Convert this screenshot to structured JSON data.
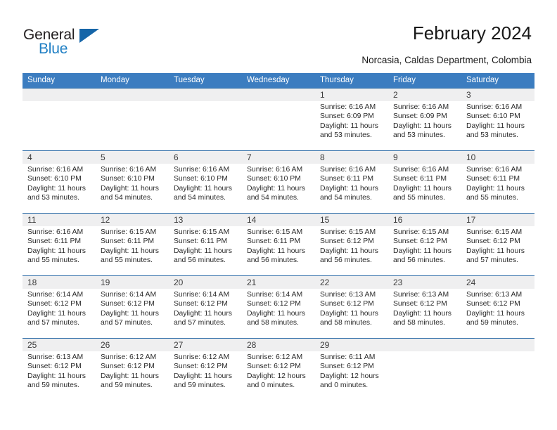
{
  "brand": {
    "name_top": "General",
    "name_bottom": "Blue"
  },
  "header": {
    "title": "February 2024",
    "subtitle": "Norcasia, Caldas Department, Colombia"
  },
  "colors": {
    "header_blue": "#3c7dc0",
    "row_divider_blue": "#2e6da8",
    "daynum_band_gray": "#efeff0",
    "brand_blue": "#1f7fc4",
    "brand_dark": "#231f20"
  },
  "weekdays": [
    "Sunday",
    "Monday",
    "Tuesday",
    "Wednesday",
    "Thursday",
    "Friday",
    "Saturday"
  ],
  "weeks": [
    [
      {
        "day": "",
        "sunrise": "",
        "sunset": "",
        "daylight1": "",
        "daylight2": ""
      },
      {
        "day": "",
        "sunrise": "",
        "sunset": "",
        "daylight1": "",
        "daylight2": ""
      },
      {
        "day": "",
        "sunrise": "",
        "sunset": "",
        "daylight1": "",
        "daylight2": ""
      },
      {
        "day": "",
        "sunrise": "",
        "sunset": "",
        "daylight1": "",
        "daylight2": ""
      },
      {
        "day": "1",
        "sunrise": "Sunrise: 6:16 AM",
        "sunset": "Sunset: 6:09 PM",
        "daylight1": "Daylight: 11 hours",
        "daylight2": "and 53 minutes."
      },
      {
        "day": "2",
        "sunrise": "Sunrise: 6:16 AM",
        "sunset": "Sunset: 6:09 PM",
        "daylight1": "Daylight: 11 hours",
        "daylight2": "and 53 minutes."
      },
      {
        "day": "3",
        "sunrise": "Sunrise: 6:16 AM",
        "sunset": "Sunset: 6:10 PM",
        "daylight1": "Daylight: 11 hours",
        "daylight2": "and 53 minutes."
      }
    ],
    [
      {
        "day": "4",
        "sunrise": "Sunrise: 6:16 AM",
        "sunset": "Sunset: 6:10 PM",
        "daylight1": "Daylight: 11 hours",
        "daylight2": "and 53 minutes."
      },
      {
        "day": "5",
        "sunrise": "Sunrise: 6:16 AM",
        "sunset": "Sunset: 6:10 PM",
        "daylight1": "Daylight: 11 hours",
        "daylight2": "and 54 minutes."
      },
      {
        "day": "6",
        "sunrise": "Sunrise: 6:16 AM",
        "sunset": "Sunset: 6:10 PM",
        "daylight1": "Daylight: 11 hours",
        "daylight2": "and 54 minutes."
      },
      {
        "day": "7",
        "sunrise": "Sunrise: 6:16 AM",
        "sunset": "Sunset: 6:10 PM",
        "daylight1": "Daylight: 11 hours",
        "daylight2": "and 54 minutes."
      },
      {
        "day": "8",
        "sunrise": "Sunrise: 6:16 AM",
        "sunset": "Sunset: 6:11 PM",
        "daylight1": "Daylight: 11 hours",
        "daylight2": "and 54 minutes."
      },
      {
        "day": "9",
        "sunrise": "Sunrise: 6:16 AM",
        "sunset": "Sunset: 6:11 PM",
        "daylight1": "Daylight: 11 hours",
        "daylight2": "and 55 minutes."
      },
      {
        "day": "10",
        "sunrise": "Sunrise: 6:16 AM",
        "sunset": "Sunset: 6:11 PM",
        "daylight1": "Daylight: 11 hours",
        "daylight2": "and 55 minutes."
      }
    ],
    [
      {
        "day": "11",
        "sunrise": "Sunrise: 6:16 AM",
        "sunset": "Sunset: 6:11 PM",
        "daylight1": "Daylight: 11 hours",
        "daylight2": "and 55 minutes."
      },
      {
        "day": "12",
        "sunrise": "Sunrise: 6:15 AM",
        "sunset": "Sunset: 6:11 PM",
        "daylight1": "Daylight: 11 hours",
        "daylight2": "and 55 minutes."
      },
      {
        "day": "13",
        "sunrise": "Sunrise: 6:15 AM",
        "sunset": "Sunset: 6:11 PM",
        "daylight1": "Daylight: 11 hours",
        "daylight2": "and 56 minutes."
      },
      {
        "day": "14",
        "sunrise": "Sunrise: 6:15 AM",
        "sunset": "Sunset: 6:11 PM",
        "daylight1": "Daylight: 11 hours",
        "daylight2": "and 56 minutes."
      },
      {
        "day": "15",
        "sunrise": "Sunrise: 6:15 AM",
        "sunset": "Sunset: 6:12 PM",
        "daylight1": "Daylight: 11 hours",
        "daylight2": "and 56 minutes."
      },
      {
        "day": "16",
        "sunrise": "Sunrise: 6:15 AM",
        "sunset": "Sunset: 6:12 PM",
        "daylight1": "Daylight: 11 hours",
        "daylight2": "and 56 minutes."
      },
      {
        "day": "17",
        "sunrise": "Sunrise: 6:15 AM",
        "sunset": "Sunset: 6:12 PM",
        "daylight1": "Daylight: 11 hours",
        "daylight2": "and 57 minutes."
      }
    ],
    [
      {
        "day": "18",
        "sunrise": "Sunrise: 6:14 AM",
        "sunset": "Sunset: 6:12 PM",
        "daylight1": "Daylight: 11 hours",
        "daylight2": "and 57 minutes."
      },
      {
        "day": "19",
        "sunrise": "Sunrise: 6:14 AM",
        "sunset": "Sunset: 6:12 PM",
        "daylight1": "Daylight: 11 hours",
        "daylight2": "and 57 minutes."
      },
      {
        "day": "20",
        "sunrise": "Sunrise: 6:14 AM",
        "sunset": "Sunset: 6:12 PM",
        "daylight1": "Daylight: 11 hours",
        "daylight2": "and 57 minutes."
      },
      {
        "day": "21",
        "sunrise": "Sunrise: 6:14 AM",
        "sunset": "Sunset: 6:12 PM",
        "daylight1": "Daylight: 11 hours",
        "daylight2": "and 58 minutes."
      },
      {
        "day": "22",
        "sunrise": "Sunrise: 6:13 AM",
        "sunset": "Sunset: 6:12 PM",
        "daylight1": "Daylight: 11 hours",
        "daylight2": "and 58 minutes."
      },
      {
        "day": "23",
        "sunrise": "Sunrise: 6:13 AM",
        "sunset": "Sunset: 6:12 PM",
        "daylight1": "Daylight: 11 hours",
        "daylight2": "and 58 minutes."
      },
      {
        "day": "24",
        "sunrise": "Sunrise: 6:13 AM",
        "sunset": "Sunset: 6:12 PM",
        "daylight1": "Daylight: 11 hours",
        "daylight2": "and 59 minutes."
      }
    ],
    [
      {
        "day": "25",
        "sunrise": "Sunrise: 6:13 AM",
        "sunset": "Sunset: 6:12 PM",
        "daylight1": "Daylight: 11 hours",
        "daylight2": "and 59 minutes."
      },
      {
        "day": "26",
        "sunrise": "Sunrise: 6:12 AM",
        "sunset": "Sunset: 6:12 PM",
        "daylight1": "Daylight: 11 hours",
        "daylight2": "and 59 minutes."
      },
      {
        "day": "27",
        "sunrise": "Sunrise: 6:12 AM",
        "sunset": "Sunset: 6:12 PM",
        "daylight1": "Daylight: 11 hours",
        "daylight2": "and 59 minutes."
      },
      {
        "day": "28",
        "sunrise": "Sunrise: 6:12 AM",
        "sunset": "Sunset: 6:12 PM",
        "daylight1": "Daylight: 12 hours",
        "daylight2": "and 0 minutes."
      },
      {
        "day": "29",
        "sunrise": "Sunrise: 6:11 AM",
        "sunset": "Sunset: 6:12 PM",
        "daylight1": "Daylight: 12 hours",
        "daylight2": "and 0 minutes."
      },
      {
        "day": "",
        "sunrise": "",
        "sunset": "",
        "daylight1": "",
        "daylight2": ""
      },
      {
        "day": "",
        "sunrise": "",
        "sunset": "",
        "daylight1": "",
        "daylight2": ""
      }
    ]
  ]
}
